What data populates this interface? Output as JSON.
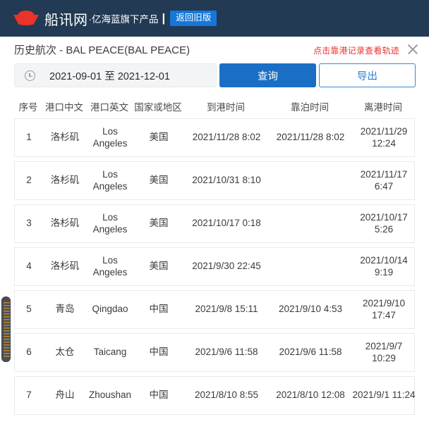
{
  "brand": {
    "logo_icon": "boat-logo-icon",
    "name": "船讯网",
    "subtitle": "·亿海蓝旗下产品",
    "divider": "|",
    "old_version_label": "返回旧版",
    "bar_color": "#223a53",
    "logo_color": "#e8342a",
    "button_color": "#1677d8"
  },
  "panel": {
    "title": "历史航次 - BAL PEACE(BAL PEACE)",
    "hint": "点击靠港记录查看轨迹",
    "hint_color": "#e8332c",
    "close_icon": "close-icon"
  },
  "toolbar": {
    "date_icon": "clock-icon",
    "date_range_value": "2021-09-01 至 2021-12-01",
    "date_range_placeholder": "请选择日期范围",
    "query_label": "查询",
    "export_label": "导出",
    "query_color": "#1a6fc4",
    "export_color": "#2f7fd0"
  },
  "table": {
    "columns": [
      "序号",
      "港口中文",
      "港口英文",
      "国家或地区",
      "到港时间",
      "靠泊时间",
      "离港时间"
    ],
    "rows": [
      {
        "index": "1",
        "port_cn": "洛杉矶",
        "port_en": "Los Angeles",
        "country": "美国",
        "arrival": "2021/11/28 8:02",
        "berth": "2021/11/28 8:02",
        "departure": "2021/11/29 12:24"
      },
      {
        "index": "2",
        "port_cn": "洛杉矶",
        "port_en": "Los Angeles",
        "country": "美国",
        "arrival": "2021/10/31 8:10",
        "berth": "",
        "departure": "2021/11/17 6:47"
      },
      {
        "index": "3",
        "port_cn": "洛杉矶",
        "port_en": "Los Angeles",
        "country": "美国",
        "arrival": "2021/10/17 0:18",
        "berth": "",
        "departure": "2021/10/17 5:26"
      },
      {
        "index": "4",
        "port_cn": "洛杉矶",
        "port_en": "Los Angeles",
        "country": "美国",
        "arrival": "2021/9/30 22:45",
        "berth": "",
        "departure": "2021/10/14 9:19"
      },
      {
        "index": "5",
        "port_cn": "青岛",
        "port_en": "Qingdao",
        "country": "中国",
        "arrival": "2021/9/8 15:11",
        "berth": "2021/9/10 4:53",
        "departure": "2021/9/10 17:47"
      },
      {
        "index": "6",
        "port_cn": "太仓",
        "port_en": "Taicang",
        "country": "中国",
        "arrival": "2021/9/6 11:58",
        "berth": "2021/9/6 11:58",
        "departure": "2021/9/7 10:29"
      },
      {
        "index": "7",
        "port_cn": "舟山",
        "port_en": "Zhoushan",
        "country": "中国",
        "arrival": "2021/8/10 8:55",
        "berth": "2021/8/10 12:08",
        "departure": "2021/9/1 11:24"
      }
    ]
  },
  "scrollbar": {
    "icon": "vertical-scrollbar-thumb"
  }
}
